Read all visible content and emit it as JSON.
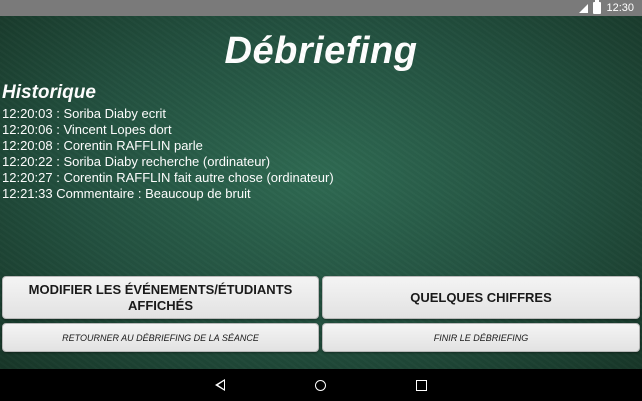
{
  "status_bar": {
    "time": "12:30"
  },
  "page": {
    "title": "Débriefing"
  },
  "history": {
    "title": "Historique",
    "entries": [
      "12:20:03 : Soriba Diaby ecrit",
      "12:20:06 : Vincent Lopes dort",
      "12:20:08 : Corentin RAFFLIN parle",
      "12:20:22 : Soriba Diaby recherche (ordinateur)",
      "12:20:27 : Corentin RAFFLIN fait autre chose (ordinateur)",
      "12:21:33 Commentaire : Beaucoup de bruit"
    ]
  },
  "buttons": {
    "modify_label": "MODIFIER LES ÉVÉNEMENTS/ÉTUDIANTS AFFICHÉS",
    "stats_label": "QUELQUES CHIFFRES",
    "return_label": "RETOURNER AU DÉBRIEFING DE LA SÉANCE",
    "finish_label": "FINIR LE DÉBRIEFING"
  },
  "icons": {
    "signal": "signal-icon",
    "battery": "battery-icon",
    "back": "nav-back-icon",
    "home": "nav-home-icon",
    "recents": "nav-recents-icon"
  }
}
